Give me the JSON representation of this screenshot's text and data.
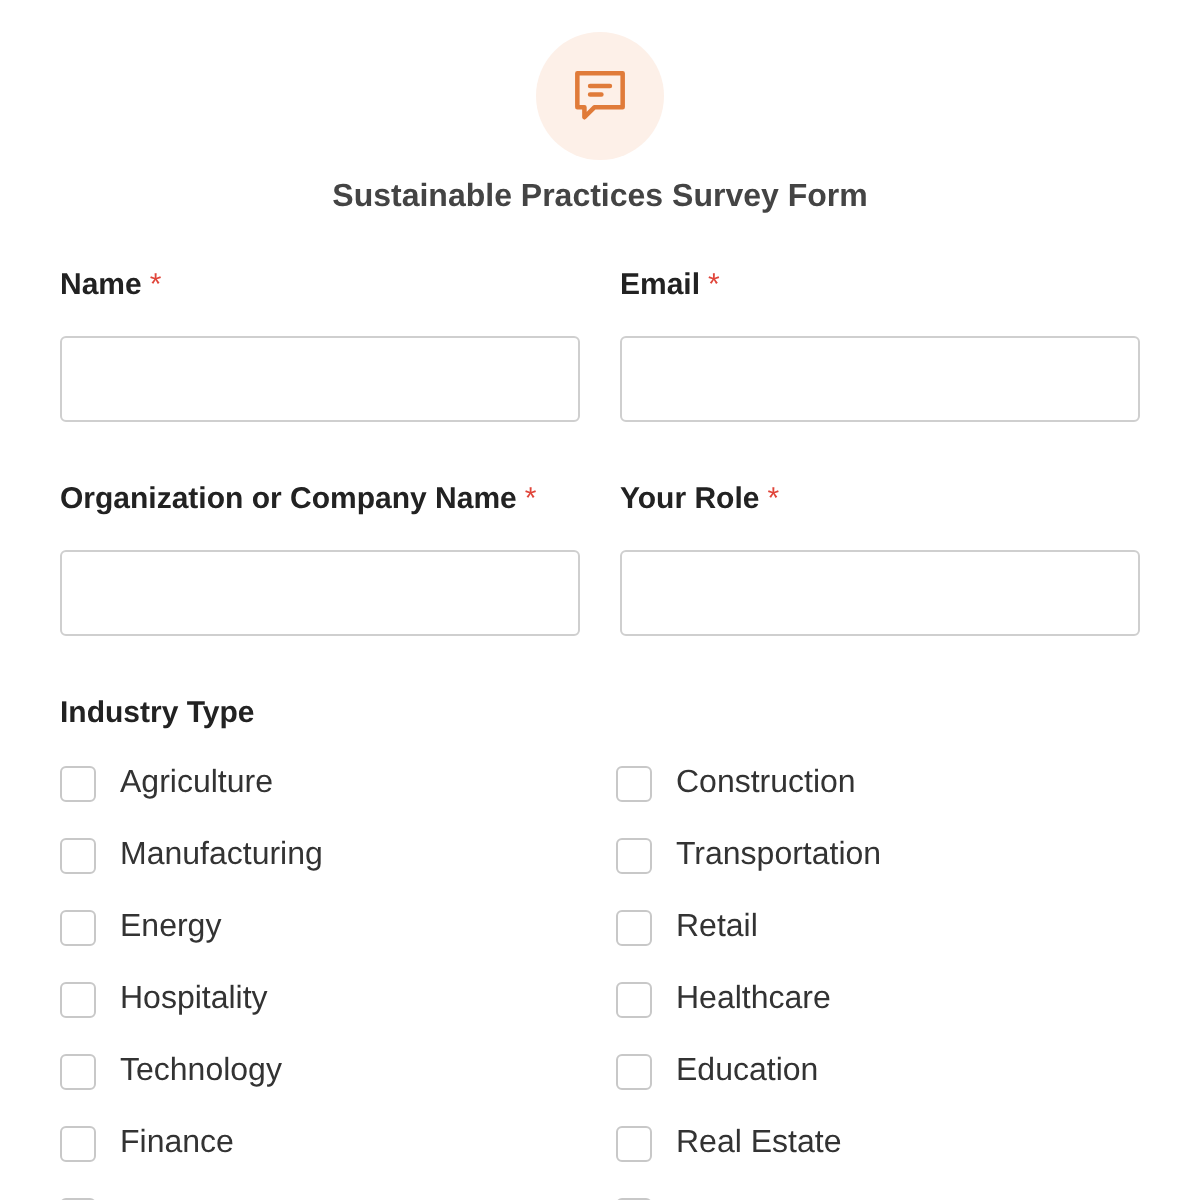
{
  "form": {
    "title": "Sustainable Practices Survey Form"
  },
  "fields": [
    {
      "label": "Name",
      "required_mark": "*"
    },
    {
      "label": "Email",
      "required_mark": "*"
    },
    {
      "label": "Organization or Company Name",
      "required_mark": "*"
    },
    {
      "label": "Your Role",
      "required_mark": "*"
    }
  ],
  "industry": {
    "label": "Industry Type",
    "options": [
      {
        "label": "Agriculture",
        "checked": false
      },
      {
        "label": "Construction",
        "checked": false
      },
      {
        "label": "Manufacturing",
        "checked": false
      },
      {
        "label": "Transportation",
        "checked": false
      },
      {
        "label": "Energy",
        "checked": false
      },
      {
        "label": "Retail",
        "checked": false
      },
      {
        "label": "Hospitality",
        "checked": false
      },
      {
        "label": "Healthcare",
        "checked": false
      },
      {
        "label": "Technology",
        "checked": false
      },
      {
        "label": "Education",
        "checked": false
      },
      {
        "label": "Finance",
        "checked": false
      },
      {
        "label": "Real Estate",
        "checked": false
      },
      {
        "checked": false
      },
      {
        "checked": false
      }
    ]
  }
}
